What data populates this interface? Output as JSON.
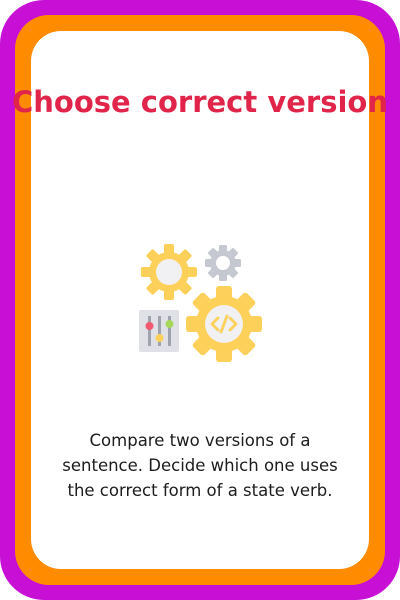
{
  "card": {
    "title": "Choose correct version",
    "icon": "gears-code-settings-icon",
    "description": "Compare two versions of a sentence. Decide which one uses the correct form of a state verb."
  },
  "colors": {
    "outer_border": "#c70fd6",
    "inner_border": "#ff8c00",
    "title": "#e0244a",
    "gear_yellow": "#fdd05a",
    "gear_gray": "#c5c8d0"
  }
}
